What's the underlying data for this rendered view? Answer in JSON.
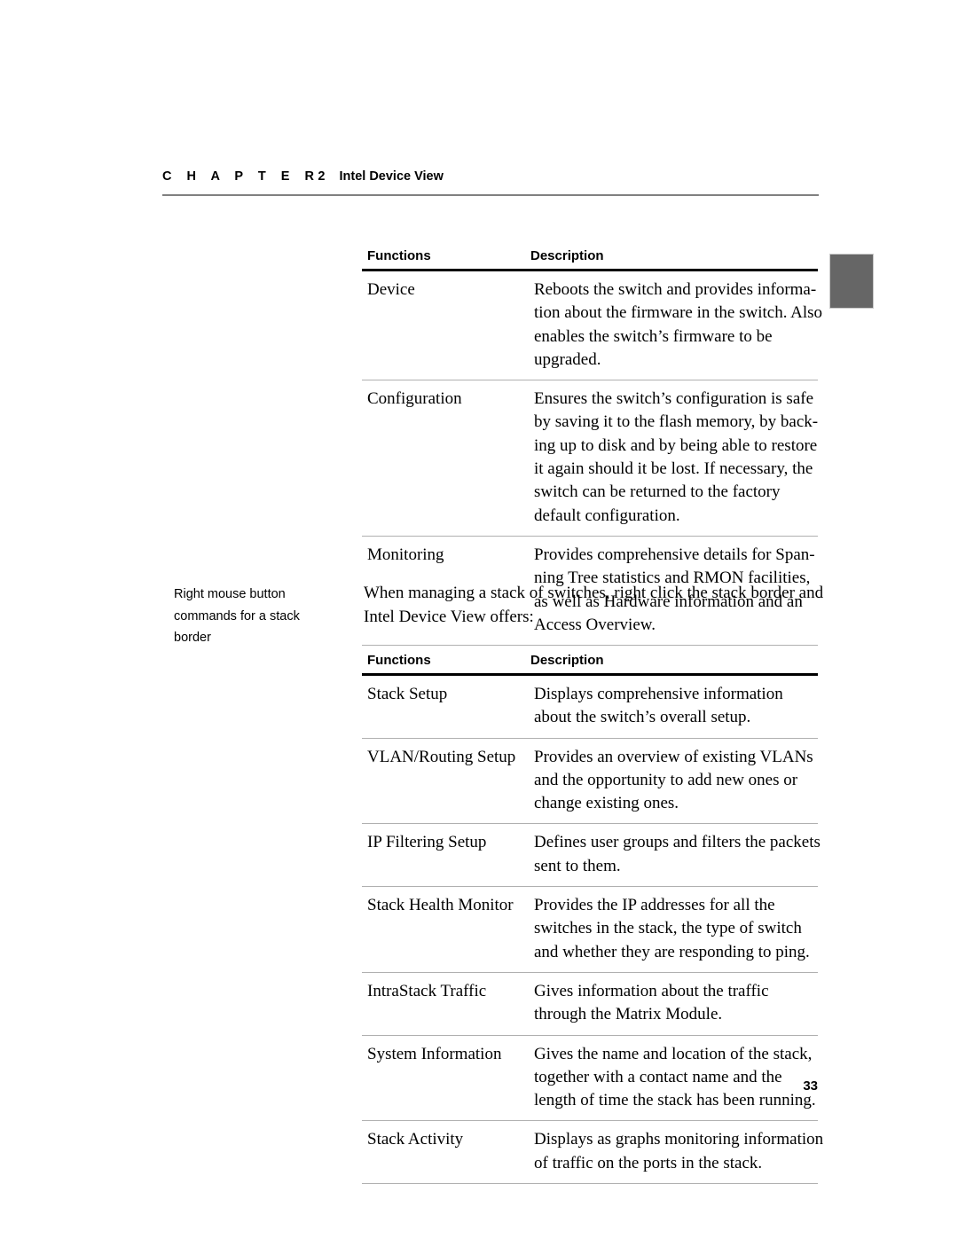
{
  "header": {
    "chapter_word": "C H A P T E R",
    "chapter_number": "2",
    "chapter_title": "Intel Device View"
  },
  "margin_note": {
    "lines": [
      "Right mouse button",
      "commands for a stack",
      "border"
    ]
  },
  "body_paragraph": {
    "lines": [
      "When managing a stack of switches, right click the stack border and",
      "Intel Device View offers:"
    ]
  },
  "tables": [
    {
      "name": "device-functions-table",
      "headers": {
        "functions": "Functions",
        "description": "Description"
      },
      "rows": [
        {
          "function": "Device",
          "description_lines": [
            "Reboots the switch and provides informa-",
            "tion about the firmware in the switch. Also",
            "enables the switch’s firmware to be",
            "upgraded."
          ]
        },
        {
          "function": "Configuration",
          "description_lines": [
            "Ensures the switch’s configuration is safe",
            "by saving it to the flash memory, by back-",
            "ing up to disk and by being able to restore",
            "it again should it be lost. If necessary, the",
            "switch can be returned to the factory",
            "default configuration."
          ]
        },
        {
          "function": "Monitoring",
          "description_lines": [
            "Provides comprehensive details for Span-",
            "ning Tree statistics and RMON facilities,",
            "as well as Hardware information and an",
            "Access Overview."
          ]
        }
      ]
    },
    {
      "name": "stack-border-functions-table",
      "headers": {
        "functions": "Functions",
        "description": "Description"
      },
      "rows": [
        {
          "function": "Stack Setup",
          "description_lines": [
            "Displays comprehensive information",
            "about the switch’s overall setup."
          ]
        },
        {
          "function": "VLAN/Routing Setup",
          "description_lines": [
            "Provides an overview of existing VLANs",
            "and the opportunity to add new ones or",
            "change existing ones."
          ]
        },
        {
          "function": "IP Filtering Setup",
          "description_lines": [
            "Defines user groups and filters the packets",
            "sent to them."
          ]
        },
        {
          "function": "Stack Health Monitor",
          "description_lines": [
            "Provides the IP addresses for all the",
            "switches in the stack, the type of switch",
            "and whether they are responding to ping."
          ]
        },
        {
          "function": "IntraStack Traffic",
          "description_lines": [
            "Gives information about the traffic",
            "through the Matrix Module."
          ]
        },
        {
          "function": "System Information",
          "description_lines": [
            "Gives the name and location of the stack,",
            "together with a contact name and the",
            "length of time the stack has been running."
          ]
        },
        {
          "function": "Stack Activity",
          "description_lines": [
            "Displays as graphs monitoring information",
            "of traffic on the ports in the stack."
          ]
        }
      ]
    }
  ],
  "folio": {
    "page_number": "33"
  },
  "colors": {
    "text": "#000000",
    "header_rule": "#808080",
    "table_rule_heavy": "#000000",
    "table_rule_light": "#b0b0b0",
    "edge_tab": "#666666"
  }
}
